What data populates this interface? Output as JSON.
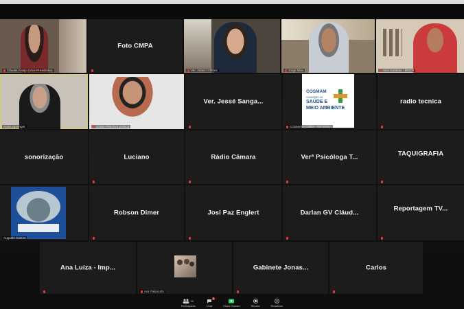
{
  "tiles": {
    "t1": {
      "caption": "Cláudia Araújo (Vice-Presidente)"
    },
    "t2": {
      "label": "Foto CMPA"
    },
    "t3": {
      "caption": "Ver. Aldacir Oliboni"
    },
    "t4": {
      "caption": "Jorge Mira"
    },
    "t5": {
      "caption": "Alex Cardoso - MNCR"
    },
    "t6": {
      "caption": "urdes Sprenger"
    },
    "t7": {
      "caption": "JOSÉ FREITAS política"
    },
    "t8": {
      "label": "Ver. Jessé Sanga..."
    },
    "t9": {
      "caption": "COSMAM_Cidilla - Secretário",
      "logo_title": "COSMAM",
      "logo_line1": "COMISSÃO DE",
      "logo_line2": "SAÚDE E",
      "logo_line3": "MEIO AMBIENTE"
    },
    "t10": {
      "label": "radio tecnica"
    },
    "t11": {
      "label": "sonorização"
    },
    "t12": {
      "label": "Luciano"
    },
    "t13": {
      "label": "Rádio Câmara"
    },
    "t14": {
      "label": "Verª Psicóloga T..."
    },
    "t15": {
      "label": "TAQUIGRAFIA"
    },
    "t16": {
      "caption": "Augusto Santos"
    },
    "t17": {
      "label": "Robson Dimer"
    },
    "t18": {
      "label": "Josi Paz Englert"
    },
    "t19": {
      "label": "Darlan GV Cláud..."
    },
    "t20": {
      "label": "Reportagem TV..."
    },
    "t21": {
      "label": "Ana Luíza - Imp..."
    },
    "t22": {
      "caption": "Acir Falcocchi"
    },
    "t23": {
      "label": "Gabinete Jonas..."
    },
    "t24": {
      "label": "Carlos"
    }
  },
  "toolbar": {
    "participants_label": "Participants",
    "participants_count": "24",
    "chat_label": "Chat",
    "chat_badge": "3",
    "share_label": "Share Screen",
    "record_label": "Record",
    "reactions_label": "Reactions"
  },
  "colors": {
    "tile_bg": "#1c1c1c",
    "active_speaker": "#d8d25a",
    "muted_mic": "#e23b3b",
    "share_green": "#2bd36a",
    "cosmam_blue": "#1f4f8c",
    "cosmam_green": "#3c9a4a"
  }
}
